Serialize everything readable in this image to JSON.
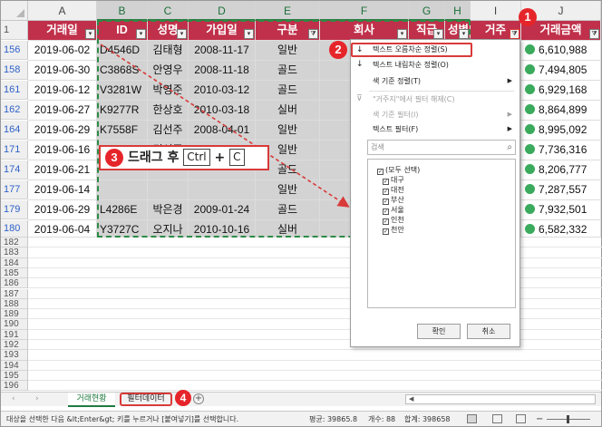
{
  "columns": [
    "A",
    "B",
    "C",
    "D",
    "E",
    "F",
    "G",
    "H",
    "I",
    "J"
  ],
  "headers": [
    "거래일",
    "ID",
    "성명",
    "가입일",
    "구분",
    "회사",
    "직급",
    "성별",
    "거주",
    "거래금액"
  ],
  "rows": [
    {
      "num": "156",
      "date": "2019-06-02",
      "id": "D4546D",
      "name": "김태형",
      "join": "2008-11-17",
      "type": "일반",
      "company": "",
      "amount": "6,610,988"
    },
    {
      "num": "158",
      "date": "2019-06-30",
      "id": "C3868S",
      "name": "안영우",
      "join": "2008-11-18",
      "type": "골드",
      "company": "대",
      "amount": "7,494,805"
    },
    {
      "num": "161",
      "date": "2019-06-12",
      "id": "V3281W",
      "name": "박영준",
      "join": "2010-03-12",
      "type": "골드",
      "company": "백",
      "amount": "6,929,168"
    },
    {
      "num": "162",
      "date": "2019-06-27",
      "id": "K9277R",
      "name": "한상호",
      "join": "2010-03-18",
      "type": "실버",
      "company": "금",
      "amount": "8,864,899"
    },
    {
      "num": "164",
      "date": "2019-06-29",
      "id": "K7558F",
      "name": "김선주",
      "join": "2008-04-01",
      "type": "일반",
      "company": "신",
      "amount": "8,995,092"
    },
    {
      "num": "171",
      "date": "2019-06-16",
      "id": "S2802F",
      "name": "김성준",
      "join": "2009-04-10",
      "type": "일반",
      "company": "한",
      "amount": "7,736,316"
    },
    {
      "num": "174",
      "date": "2019-06-21",
      "id": "",
      "name": "",
      "join": "",
      "type": "골드",
      "company": "권",
      "amount": "8,206,777"
    },
    {
      "num": "177",
      "date": "2019-06-14",
      "id": "",
      "name": "",
      "join": "",
      "type": "일반",
      "company": "동",
      "amount": "7,287,557"
    },
    {
      "num": "179",
      "date": "2019-06-29",
      "id": "L4286E",
      "name": "박은경",
      "join": "2009-01-24",
      "type": "골드",
      "company": "서",
      "amount": "7,932,501"
    },
    {
      "num": "180",
      "date": "2019-06-04",
      "id": "Y3727C",
      "name": "오지나",
      "join": "2010-10-16",
      "type": "실버",
      "company": "화",
      "amount": "6,582,332"
    }
  ],
  "empty_rows": [
    "182",
    "183",
    "184",
    "185",
    "186",
    "187",
    "188",
    "189",
    "190",
    "191",
    "192",
    "193",
    "194",
    "195",
    "196"
  ],
  "header_row_num": "1",
  "callout": {
    "badge": "3",
    "text": "드래그 후",
    "key1": "Ctrl",
    "plus": "+",
    "key2": "C"
  },
  "badges": {
    "filter": "1",
    "sort": "2",
    "tab": "4"
  },
  "filter_menu": {
    "sort_asc": "텍스트 오름차순 정렬(S)",
    "sort_desc": "텍스트 내림차순 정렬(O)",
    "sort_color": "색 기준 정렬(T)",
    "clear_filter": "\"거주지\"에서 필터 해제(C)",
    "filter_color": "색 기준 필터(I)",
    "text_filter": "텍스트 필터(F)",
    "search_placeholder": "검색",
    "items": [
      "(모두 선택)",
      "대구",
      "대전",
      "부산",
      "서울",
      "인천",
      "천안"
    ],
    "ok": "확인",
    "cancel": "취소"
  },
  "sheet_tabs": [
    "거래현황",
    "필터데이터"
  ],
  "status": {
    "message": "대상을 선택한 다음 &lt;Enter&gt; 키를 누르거나 [붙여넣기]를 선택합니다.",
    "average": "평균: 39865.8",
    "count": "개수: 88",
    "sum": "합계: 398658"
  },
  "colors": {
    "header_fill": "#c0304a",
    "accent": "#e5252a",
    "selection": "#2e8b46",
    "amount_dot": "#3aaa5c"
  }
}
